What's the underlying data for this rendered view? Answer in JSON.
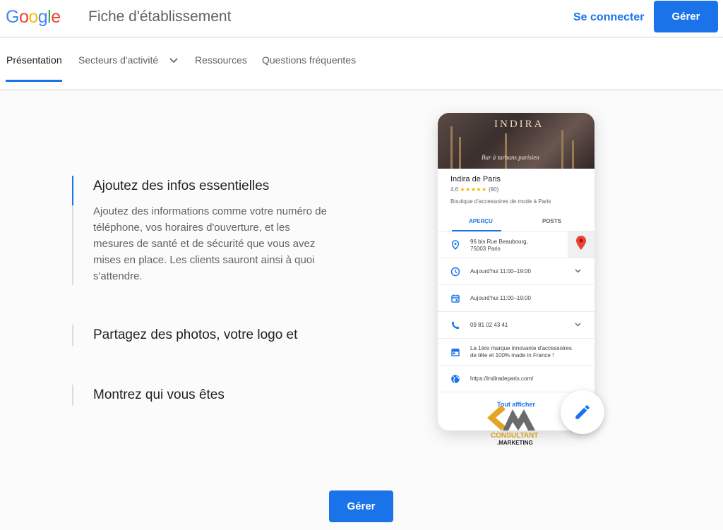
{
  "header": {
    "logo_letters": [
      "G",
      "o",
      "o",
      "g",
      "l",
      "e"
    ],
    "product_title": "Fiche d'établissement",
    "signin_label": "Se connecter",
    "manage_label": "Gérer"
  },
  "nav": {
    "items": [
      {
        "label": "Présentation",
        "active": true
      },
      {
        "label": "Secteurs d'activité",
        "has_dropdown": true
      },
      {
        "label": "Ressources"
      },
      {
        "label": "Questions fréquentes"
      }
    ]
  },
  "features": [
    {
      "title": "Ajoutez des infos essentielles",
      "description": "Ajoutez des informations comme votre numéro de téléphone, vos horaires d'ouverture, et les mesures de santé et de sécurité que vous avez mises en place. Les clients sauront ainsi à quoi s'attendre.",
      "active": true
    },
    {
      "title": "Partagez des photos, votre logo et"
    },
    {
      "title": "Montrez qui vous êtes"
    }
  ],
  "card": {
    "hero_brand": "INDIRA",
    "hero_script": "Bar à turbans parisien",
    "business_name": "Indira de Paris",
    "rating_value": "4.6",
    "stars": "★★★★★",
    "review_count": "(90)",
    "category": "Boutique d'accessoires de mode à Paris",
    "tabs": [
      "APERÇU",
      "POSTS"
    ],
    "rows": [
      {
        "icon": "location-pin-icon",
        "text_line1": "96 bis Rue Beaubourg,",
        "text_line2": "75003 Paris"
      },
      {
        "icon": "clock-icon",
        "text": "Aujourd'hui 11:00–19:00",
        "expandable": true
      },
      {
        "icon": "calendar-icon",
        "text": "Aujourd'hui 11:00–19:00"
      },
      {
        "icon": "phone-icon",
        "text": "09 81 02 43 41",
        "expandable": true
      },
      {
        "icon": "store-icon",
        "text_line1": "La 1ère marque innovante d'accessoires",
        "text_line2": "de tête et 100% made in France !"
      },
      {
        "icon": "globe-icon",
        "text": "https://indiradeparis.com/"
      }
    ],
    "show_all_label": "Tout afficher"
  },
  "watermark": {
    "line1": "CONSULTANT",
    "line2": ".MARKETING"
  },
  "cta": {
    "label": "Gérer"
  },
  "colors": {
    "accent": "#1a73e8",
    "google_blue": "#4285f4",
    "google_red": "#ea4335",
    "google_yellow": "#fbbc05",
    "google_green": "#34a853"
  }
}
